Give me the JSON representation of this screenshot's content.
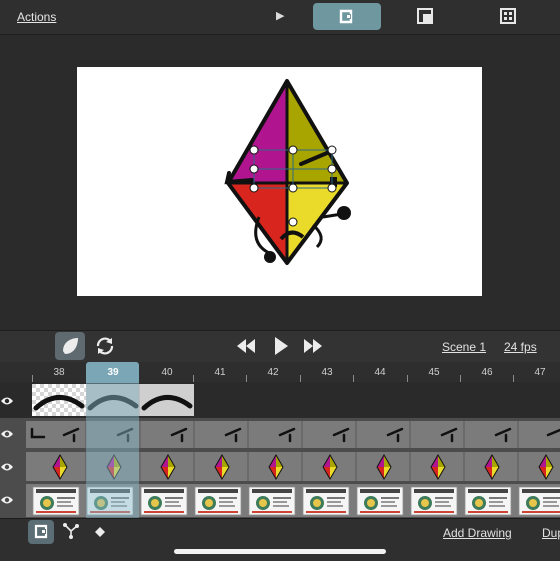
{
  "topbar": {
    "actions_label": "Actions",
    "play_icon": "play-icon",
    "tools": [
      "transform-tool-icon",
      "layers-icon",
      "grid-icon"
    ],
    "active_tool": "transform-tool-icon",
    "accent": "#6f97a0"
  },
  "transport": {
    "scene_label": "Scene 1",
    "fps_label": "24 fps",
    "buttons": [
      "onion-skin-icon",
      "loop-icon",
      "rewind-icon",
      "play-icon",
      "fast-forward-icon"
    ]
  },
  "timeline": {
    "current_frame": "39",
    "frames": [
      "38",
      "39",
      "40",
      "41",
      "42",
      "43",
      "44",
      "45",
      "46",
      "47"
    ],
    "playhead_color": "#7aa6b6",
    "tracks": [
      "brush-stroke-track",
      "eyebrow-track",
      "diamond-character-track",
      "background-track"
    ]
  },
  "bottombar": {
    "add_drawing_label": "Add Drawing",
    "duplicate_label": "Dup",
    "buttons": [
      "snap-icon",
      "path-icon",
      "keyframe-icon"
    ]
  },
  "colors": {
    "purple": "#b0158f",
    "olive": "#a8a400",
    "red": "#d8261f",
    "yellow": "#eada2a"
  }
}
